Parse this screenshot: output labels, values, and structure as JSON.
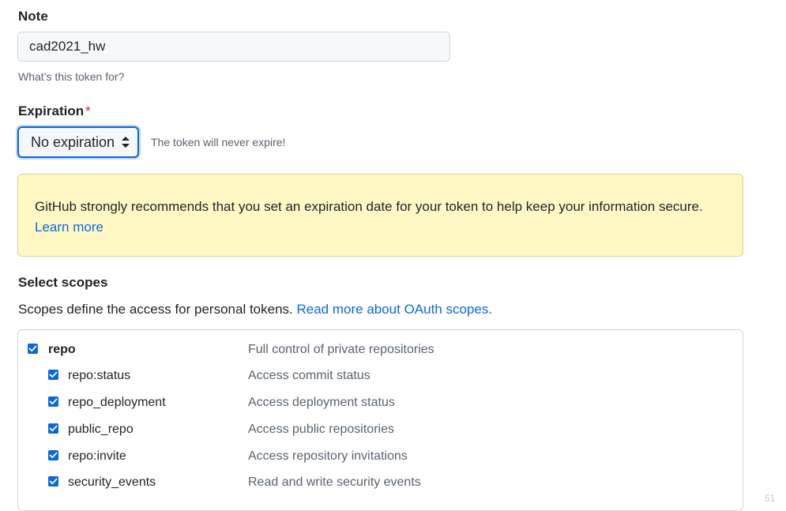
{
  "note": {
    "label": "Note",
    "value": "cad2021_hw",
    "hint": "What’s this token for?"
  },
  "expiration": {
    "label": "Expiration",
    "required_mark": "*",
    "selected": "No expiration",
    "note": "The token will never expire!"
  },
  "flash": {
    "text": "GitHub strongly recommends that you set an expiration date for your token to help keep your information secure.",
    "link": "Learn more"
  },
  "scopes": {
    "title": "Select scopes",
    "description": "Scopes define the access for personal tokens.",
    "link": "Read more about OAuth scopes.",
    "items": [
      {
        "name": "repo",
        "description": "Full control of private repositories",
        "checked": true
      },
      {
        "name": "repo:status",
        "description": "Access commit status",
        "checked": true
      },
      {
        "name": "repo_deployment",
        "description": "Access deployment status",
        "checked": true
      },
      {
        "name": "public_repo",
        "description": "Access public repositories",
        "checked": true
      },
      {
        "name": "repo:invite",
        "description": "Access repository invitations",
        "checked": true
      },
      {
        "name": "security_events",
        "description": "Read and write security events",
        "checked": true
      }
    ]
  },
  "corner_mark": "51",
  "colors": {
    "accent": "#0969da",
    "required": "#d1242f",
    "flash_bg": "#fff8c5",
    "flash_border": "#e3cf8a",
    "muted_text": "#59636e"
  }
}
